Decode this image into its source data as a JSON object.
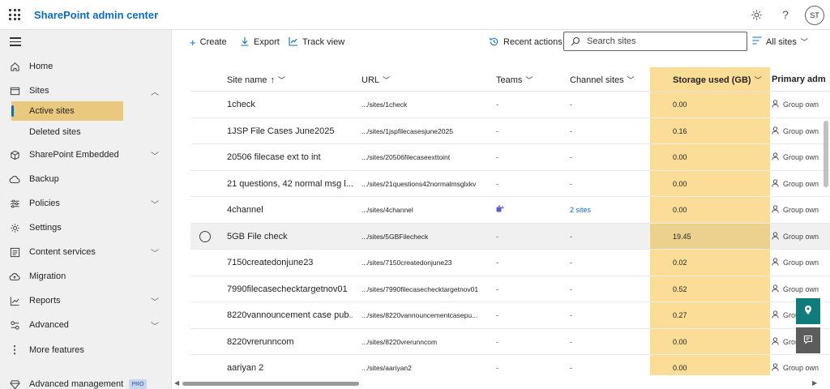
{
  "app": {
    "title": "SharePoint admin center",
    "avatar_initials": "ST"
  },
  "topbar_icons": [
    "waffle-icon",
    "gear-icon",
    "help-icon"
  ],
  "sidebar": {
    "items": [
      {
        "label": "Home",
        "icon": "home-icon"
      },
      {
        "label": "Sites",
        "icon": "sites-icon",
        "expanded": true
      },
      {
        "label": "SharePoint Embedded",
        "icon": "cube-icon",
        "expandable": true
      },
      {
        "label": "Backup",
        "icon": "cloud-backup-icon"
      },
      {
        "label": "Policies",
        "icon": "sliders-icon",
        "expandable": true
      },
      {
        "label": "Settings",
        "icon": "gear-icon"
      },
      {
        "label": "Content services",
        "icon": "content-services-icon",
        "expandable": true
      },
      {
        "label": "Migration",
        "icon": "cloud-upload-icon"
      },
      {
        "label": "Reports",
        "icon": "chart-line-icon",
        "expandable": true
      },
      {
        "label": "Advanced",
        "icon": "advanced-icon",
        "expandable": true
      },
      {
        "label": "More features",
        "icon": "more-vertical-icon"
      },
      {
        "label": "Advanced management",
        "icon": "diamond-icon",
        "badge": "PRO"
      }
    ],
    "sites_children": [
      {
        "label": "Active sites",
        "active": true
      },
      {
        "label": "Deleted sites"
      }
    ]
  },
  "toolbar": {
    "create_label": "Create",
    "export_label": "Export",
    "track_view_label": "Track view",
    "recent_actions_label": "Recent actions",
    "search_placeholder": "Search sites",
    "view_label": "All sites"
  },
  "table": {
    "columns": {
      "site_name": "Site name",
      "site_name_sort": "↑",
      "url": "URL",
      "teams": "Teams",
      "channel_sites": "Channel sites",
      "storage": "Storage used (GB)",
      "primary_admin": "Primary adm"
    },
    "rows": [
      {
        "name": "1check",
        "url": ".../sites/1check",
        "teams": "-",
        "channel": "-",
        "storage": "0.00",
        "owner": "Group own"
      },
      {
        "name": "1JSP File Cases June2025",
        "url": ".../sites/1jspfilecasesjune2025",
        "teams": "-",
        "channel": "-",
        "storage": "0.16",
        "owner": "Group own"
      },
      {
        "name": "20506 filecase ext to int",
        "url": ".../sites/20506filecaseexttoint",
        "teams": "-",
        "channel": "-",
        "storage": "0.00",
        "owner": "Group own"
      },
      {
        "name": "21 questions, 42 normal msg l...",
        "url": ".../sites/21questions42normalmsglxkv",
        "teams": "-",
        "channel": "-",
        "storage": "0.00",
        "owner": "Group own"
      },
      {
        "name": "4channel",
        "url": ".../sites/4channel",
        "teams": "teams-icon",
        "channel": "2 sites",
        "storage": "0.00",
        "owner": "Group own"
      },
      {
        "name": "5GB File check",
        "url": ".../sites/5GBFilecheck",
        "teams": "-",
        "channel": "-",
        "storage": "19.45",
        "owner": "Group own",
        "hover": true
      },
      {
        "name": "7150createdonjune23",
        "url": ".../sites/7150createdonjune23",
        "teams": "-",
        "channel": "-",
        "storage": "0.02",
        "owner": "Group own"
      },
      {
        "name": "7990filecasechecktargetnov01",
        "url": ".../sites/7990filecasechecktargetnov01",
        "teams": "-",
        "channel": "-",
        "storage": "0.52",
        "owner": "Group own"
      },
      {
        "name": "8220vannouncement case pub...",
        "url": ".../sites/8220vannouncementcasepu...",
        "teams": "-",
        "channel": "-",
        "storage": "0.27",
        "owner": "Group own"
      },
      {
        "name": "8220vrerunncom",
        "url": ".../sites/8220vrerunncom",
        "teams": "-",
        "channel": "-",
        "storage": "0.00",
        "owner": "Group own"
      },
      {
        "name": "aariyan 2",
        "url": ".../sites/aariyan2",
        "teams": "-",
        "channel": "-",
        "storage": "0.00",
        "owner": "Group own"
      }
    ]
  },
  "colors": {
    "accent": "#0f6cbd",
    "storage_highlight": "#fbdd97",
    "active_nav": "#e8c97e",
    "float_button_teal": "#0f7b7b",
    "float_button_gray": "#5c5c5c"
  }
}
